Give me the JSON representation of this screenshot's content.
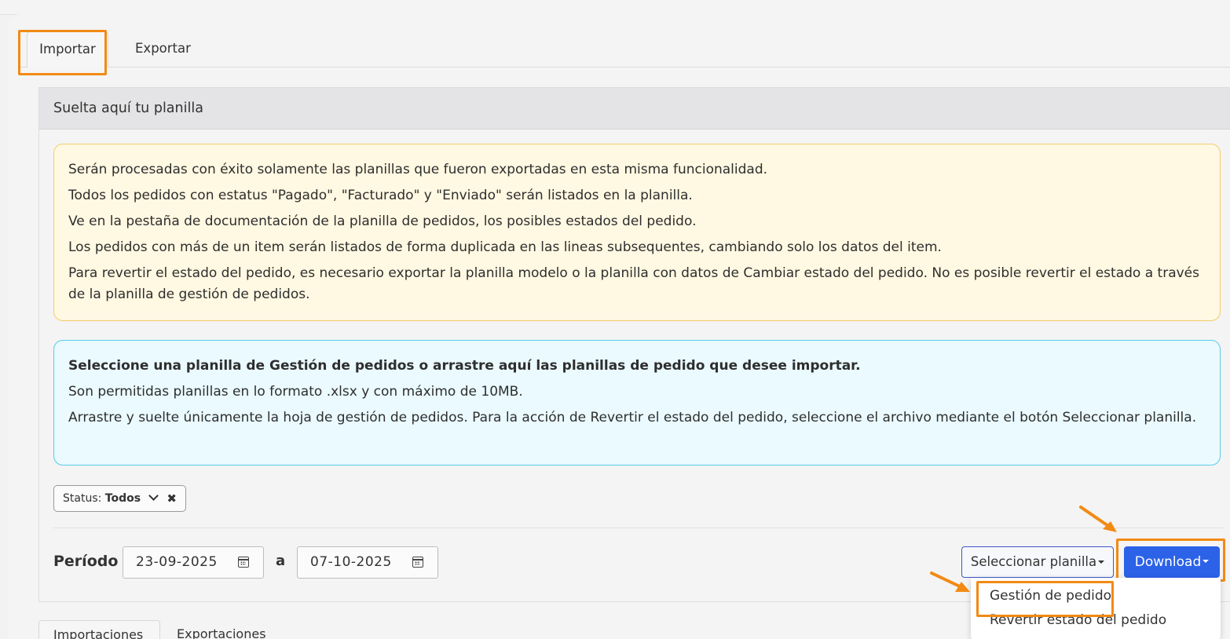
{
  "tabs": {
    "import_label": "Importar",
    "export_label": "Exportar"
  },
  "panel": {
    "title": "Suelta aquí tu planilla"
  },
  "warning_alert": {
    "lines": [
      "Serán procesadas con éxito solamente las planillas que fueron exportadas en esta misma funcionalidad.",
      "Todos los pedidos con estatus \"Pagado\", \"Facturado\" y \"Enviado\" serán listados en la planilla.",
      "Ve en la pestaña de documentación de la planilla de pedidos, los posibles estados del pedido.",
      "Los pedidos con más de un item serán listados de forma duplicada en las lineas subsequentes, cambiando solo los datos del item.",
      "Para revertir el estado del pedido, es necesario exportar la planilla modelo o la planilla con datos de Cambiar estado del pedido. No es posible revertir el estado a través de la planilla de gestión de pedidos."
    ]
  },
  "info_alert": {
    "heading": "Seleccione una planilla de Gestión de pedidos o arrastre aquí las planillas de pedido que desee importar.",
    "lines": [
      "Son permitidas planillas en lo formato .xlsx y con máximo de 10MB.",
      "Arrastre y suelte únicamente la hoja de gestión de pedidos. Para la acción de Revertir el estado del pedido, seleccione el archivo mediante el botón Seleccionar planilla."
    ]
  },
  "status_filter": {
    "prefix": "Status:",
    "value": "Todos",
    "clear_glyph": "✖"
  },
  "period": {
    "label": "Período",
    "from": "23-09-2025",
    "separator": "a",
    "to": "07-10-2025"
  },
  "actions": {
    "select_label": "Seleccionar planilla",
    "download_label": "Download"
  },
  "download_menu": {
    "items": [
      "Gestión de pedido",
      "Revertir estado del pedido"
    ]
  },
  "bottom_tabs": {
    "imports_label": "Importaciones",
    "exports_label": "Exportaciones"
  },
  "colors": {
    "highlight": "#f28a14",
    "primary": "#2c62e8",
    "warning_bg": "#fff8e2",
    "info_bg": "#eafaff"
  }
}
